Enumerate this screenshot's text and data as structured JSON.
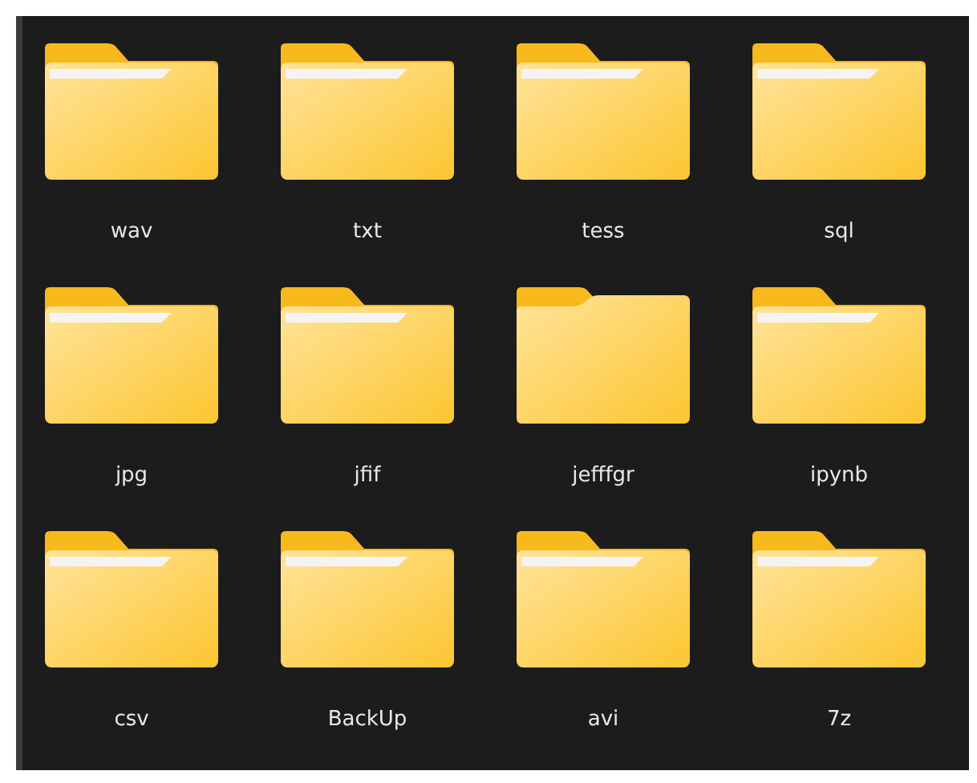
{
  "folders": [
    {
      "label": "wav",
      "kind": "filled"
    },
    {
      "label": "txt",
      "kind": "filled"
    },
    {
      "label": "tess",
      "kind": "filled"
    },
    {
      "label": "sql",
      "kind": "filled"
    },
    {
      "label": "jpg",
      "kind": "filled"
    },
    {
      "label": "jfif",
      "kind": "filled"
    },
    {
      "label": "jefffgr",
      "kind": "empty"
    },
    {
      "label": "ipynb",
      "kind": "filled"
    },
    {
      "label": "csv",
      "kind": "filled"
    },
    {
      "label": "BackUp",
      "kind": "filled"
    },
    {
      "label": "avi",
      "kind": "filled"
    },
    {
      "label": "7z",
      "kind": "filled"
    }
  ]
}
